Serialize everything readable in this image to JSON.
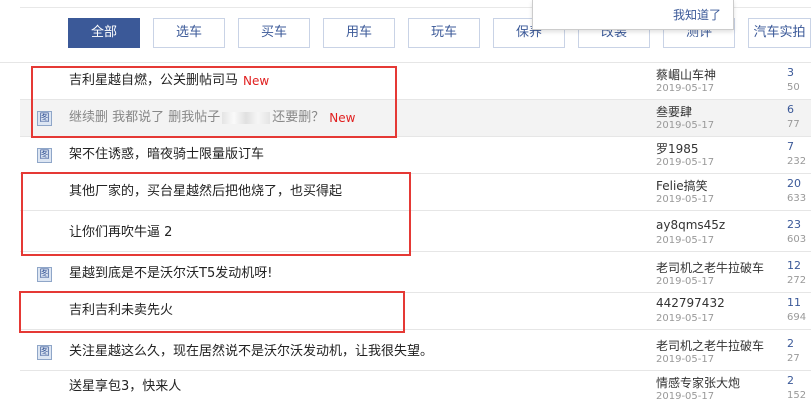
{
  "tabs": [
    {
      "label": "全部",
      "active": true
    },
    {
      "label": "选车"
    },
    {
      "label": "买车"
    },
    {
      "label": "用车"
    },
    {
      "label": "玩车"
    },
    {
      "label": "保养"
    },
    {
      "label": "改装"
    },
    {
      "label": "测评"
    },
    {
      "label": "汽车实拍"
    }
  ],
  "popup": {
    "button": "我知道了"
  },
  "posts": [
    {
      "title": "吉利星越自燃，公关删帖司马",
      "new": "New",
      "author": "蔡嵋山车神",
      "date": "2019-05-17",
      "replies": "3",
      "views": "50"
    },
    {
      "title_before": "继续删 我都说了 删我帖子",
      "title_after": "还要删？",
      "new": "New",
      "author": "叁要肆",
      "date": "2019-05-17",
      "replies": "6",
      "views": "77"
    },
    {
      "title": "架不住诱惑，暗夜骑士限量版订车",
      "author": "罗1985",
      "date": "2019-05-17",
      "replies": "7",
      "views": "232"
    },
    {
      "title": "其他厂家的，买台星越然后把他烧了，也买得起",
      "author": "Felie搞笑",
      "date": "2019-05-17",
      "replies": "20",
      "views": "633"
    },
    {
      "title": "让你们再吹牛逼 2",
      "author": "ay8qms45z",
      "date": "2019-05-17",
      "replies": "23",
      "views": "603"
    },
    {
      "title": "星越到底是不是沃尔沃T5发动机呀!",
      "author": "老司机之老牛拉破车",
      "date": "2019-05-17",
      "replies": "12",
      "views": "272"
    },
    {
      "title": "吉利吉利未卖先火",
      "author": "442797432",
      "date": "2019-05-17",
      "replies": "11",
      "views": "694"
    },
    {
      "title": "关注星越这么久，现在居然说不是沃尔沃发动机，让我很失望。",
      "author": "老司机之老牛拉破车",
      "date": "2019-05-17",
      "replies": "2",
      "views": "27"
    },
    {
      "title": "送星享包3，快来人",
      "author": "情感专家张大炮",
      "date": "2019-05-17",
      "replies": "2",
      "views": "152"
    }
  ]
}
